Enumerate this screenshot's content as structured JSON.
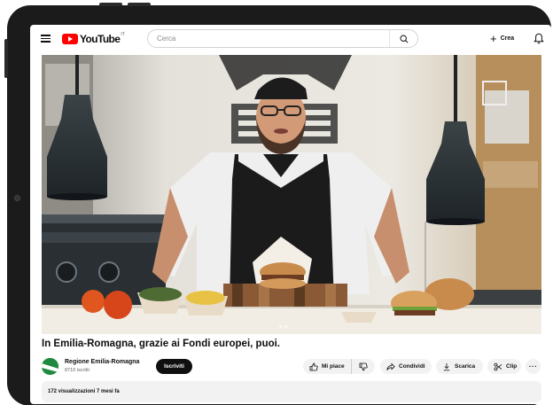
{
  "header": {
    "logo_text": "YouTube",
    "logo_region": "IT",
    "search_placeholder": "Cerca",
    "create_label": "Crea"
  },
  "video": {
    "title": "In Emilia-Romagna, grazie ai Fondi europei, puoi."
  },
  "channel": {
    "name": "Regione Emilia-Romagna",
    "subscribers": "8710 iscritti",
    "subscribe_label": "Iscriviti"
  },
  "actions": {
    "like_label": "Mi piace",
    "share_label": "Condividi",
    "download_label": "Scarica",
    "clip_label": "Clip",
    "more_label": "···"
  },
  "description": {
    "stats": "172 visualizzazioni  7 mesi fa"
  },
  "colors": {
    "brand_red": "#ff0000",
    "subscribe_bg": "#0f0f0f",
    "pill_bg": "#f2f2f2"
  },
  "icons": [
    "menu-icon",
    "youtube-logo-icon",
    "search-icon",
    "plus-icon",
    "bell-icon",
    "thumbs-up-icon",
    "thumbs-down-icon",
    "share-icon",
    "download-icon",
    "scissors-icon",
    "more-icon"
  ]
}
